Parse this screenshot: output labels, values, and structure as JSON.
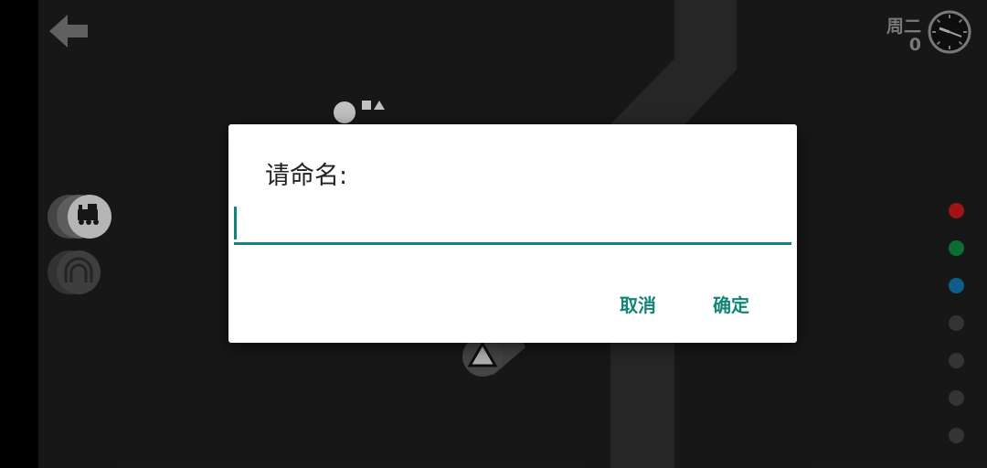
{
  "hud": {
    "day": "周二",
    "count": "0"
  },
  "icons": {
    "back": "arrow-left-icon",
    "clock": "clock-icon",
    "locomotive": "locomotive-icon",
    "tunnel": "tunnel-icon"
  },
  "lines": [
    {
      "name": "red-line",
      "color": "#b8161b",
      "active": true
    },
    {
      "name": "green-line",
      "color": "#0e7d3a",
      "active": true
    },
    {
      "name": "blue-line",
      "color": "#0f6a9c",
      "active": true
    },
    {
      "name": "line-slot-4",
      "color": "#3c3c3c",
      "active": false
    },
    {
      "name": "line-slot-5",
      "color": "#3c3c3c",
      "active": false
    },
    {
      "name": "line-slot-6",
      "color": "#3c3c3c",
      "active": false
    },
    {
      "name": "line-slot-7",
      "color": "#3c3c3c",
      "active": false
    }
  ],
  "dialog": {
    "title": "请命名:",
    "input_value": "",
    "cancel_label": "取消",
    "ok_label": "确定"
  },
  "colors": {
    "accent": "#118577",
    "background": "#1b1b1b",
    "river": "#2c2c2c"
  }
}
